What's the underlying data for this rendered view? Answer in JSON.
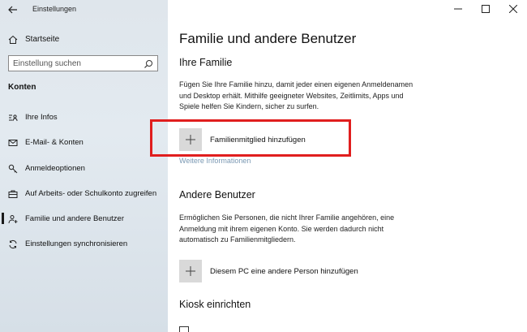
{
  "window": {
    "app_title": "Einstellungen"
  },
  "sidebar": {
    "home_label": "Startseite",
    "search_placeholder": "Einstellung suchen",
    "section_title": "Konten",
    "items": [
      {
        "label": "Ihre Infos",
        "icon": "contact-card-icon"
      },
      {
        "label": "E-Mail- & Konten",
        "icon": "mail-icon"
      },
      {
        "label": "Anmeldeoptionen",
        "icon": "key-icon"
      },
      {
        "label": "Auf Arbeits- oder Schulkonto zugreifen",
        "icon": "briefcase-icon"
      },
      {
        "label": "Familie und andere Benutzer",
        "icon": "add-person-icon",
        "active": true
      },
      {
        "label": "Einstellungen synchronisieren",
        "icon": "sync-icon"
      }
    ]
  },
  "main": {
    "page_title": "Familie und andere Benutzer",
    "family": {
      "heading": "Ihre Familie",
      "description": "Fügen Sie Ihre Familie hinzu, damit jeder einen eigenen Anmeldenamen und Desktop erhält. Mithilfe geeigneter Websites, Zeitlimits, Apps und Spiele helfen Sie Kindern, sicher zu surfen.",
      "add_label": "Familienmitglied hinzufügen",
      "more_info": "Weitere Informationen"
    },
    "others": {
      "heading": "Andere Benutzer",
      "description": "Ermöglichen Sie Personen, die nicht Ihrer Familie angehören, eine Anmeldung mit ihrem eigenen Konto. Sie werden dadurch nicht automatisch zu Familienmitgliedern.",
      "add_label": "Diesem PC eine andere Person hinzufügen"
    },
    "kiosk": {
      "heading": "Kiosk einrichten"
    }
  },
  "colors": {
    "highlight": "#e01e1e",
    "link": "#7a98b3",
    "plus_box": "#d9d9d9"
  }
}
